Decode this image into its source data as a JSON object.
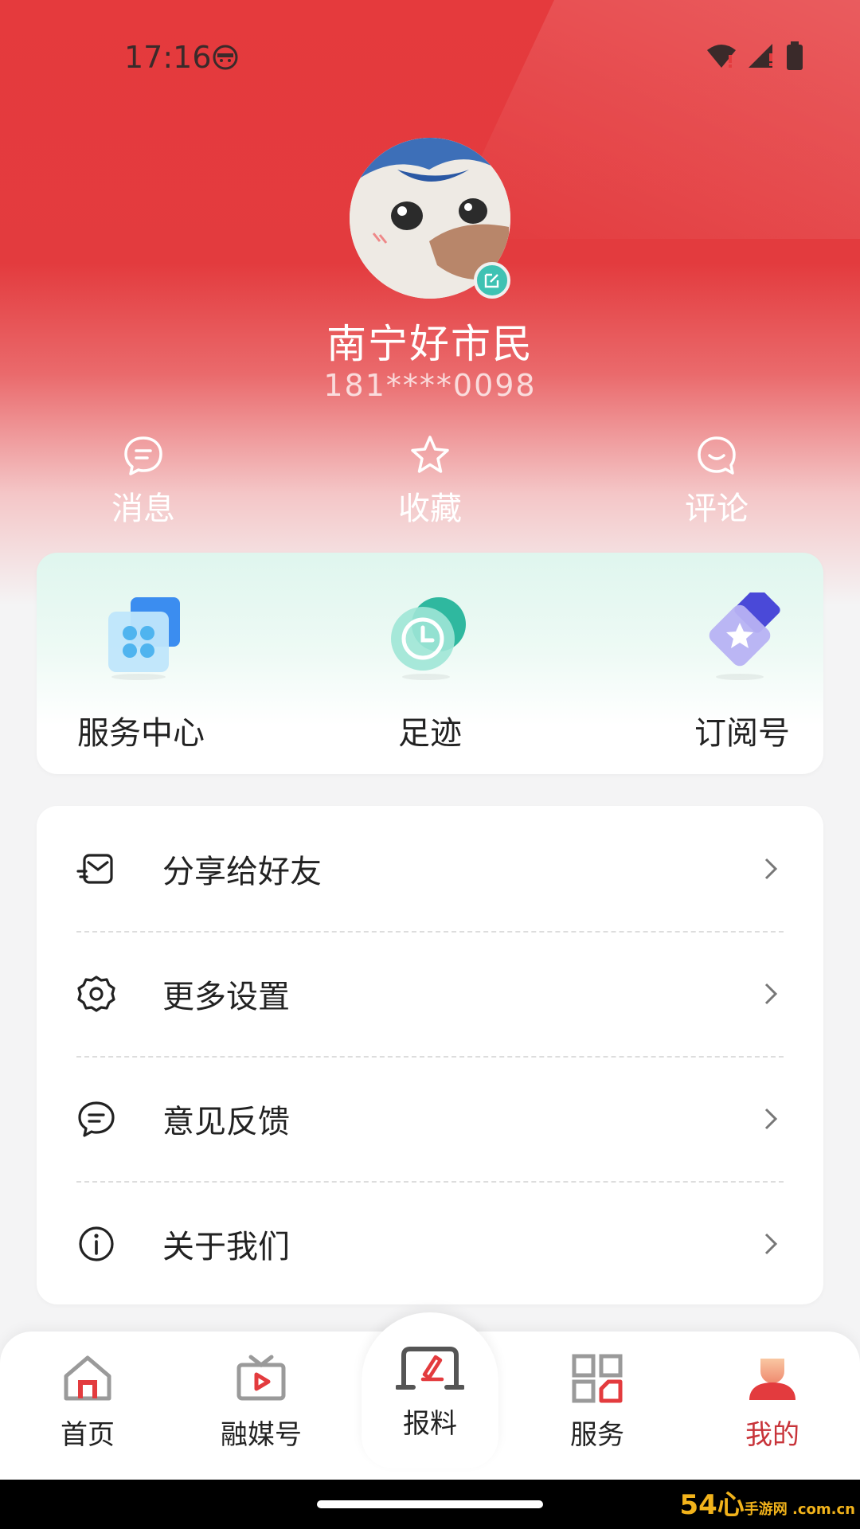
{
  "status_bar": {
    "time": "17:16"
  },
  "profile": {
    "nickname": "南宁好市民",
    "phone": "181****0098"
  },
  "quick_actions": [
    {
      "label": "消息",
      "icon": "message-icon"
    },
    {
      "label": "收藏",
      "icon": "star-icon"
    },
    {
      "label": "评论",
      "icon": "comment-icon"
    }
  ],
  "features": [
    {
      "label": "服务中心",
      "icon": "service-center-icon"
    },
    {
      "label": "足迹",
      "icon": "footprint-clock-icon"
    },
    {
      "label": "订阅号",
      "icon": "subscription-icon"
    }
  ],
  "menu": [
    {
      "label": "分享给好友",
      "icon": "share-icon"
    },
    {
      "label": "更多设置",
      "icon": "gear-icon"
    },
    {
      "label": "意见反馈",
      "icon": "feedback-icon"
    },
    {
      "label": "关于我们",
      "icon": "info-icon"
    }
  ],
  "tabs": [
    {
      "label": "首页",
      "icon": "home-icon"
    },
    {
      "label": "融媒号",
      "icon": "tv-icon"
    },
    {
      "label": "报料",
      "icon": "report-icon"
    },
    {
      "label": "服务",
      "icon": "grid-icon"
    },
    {
      "label": "我的",
      "icon": "user-icon",
      "active": true
    }
  ],
  "colors": {
    "brand_red": "#e33b3e",
    "active_tab": "#c8343a",
    "teal": "#3fc2b3"
  },
  "watermark": {
    "text": "54心",
    "sub": "手游网 .com.cn"
  }
}
